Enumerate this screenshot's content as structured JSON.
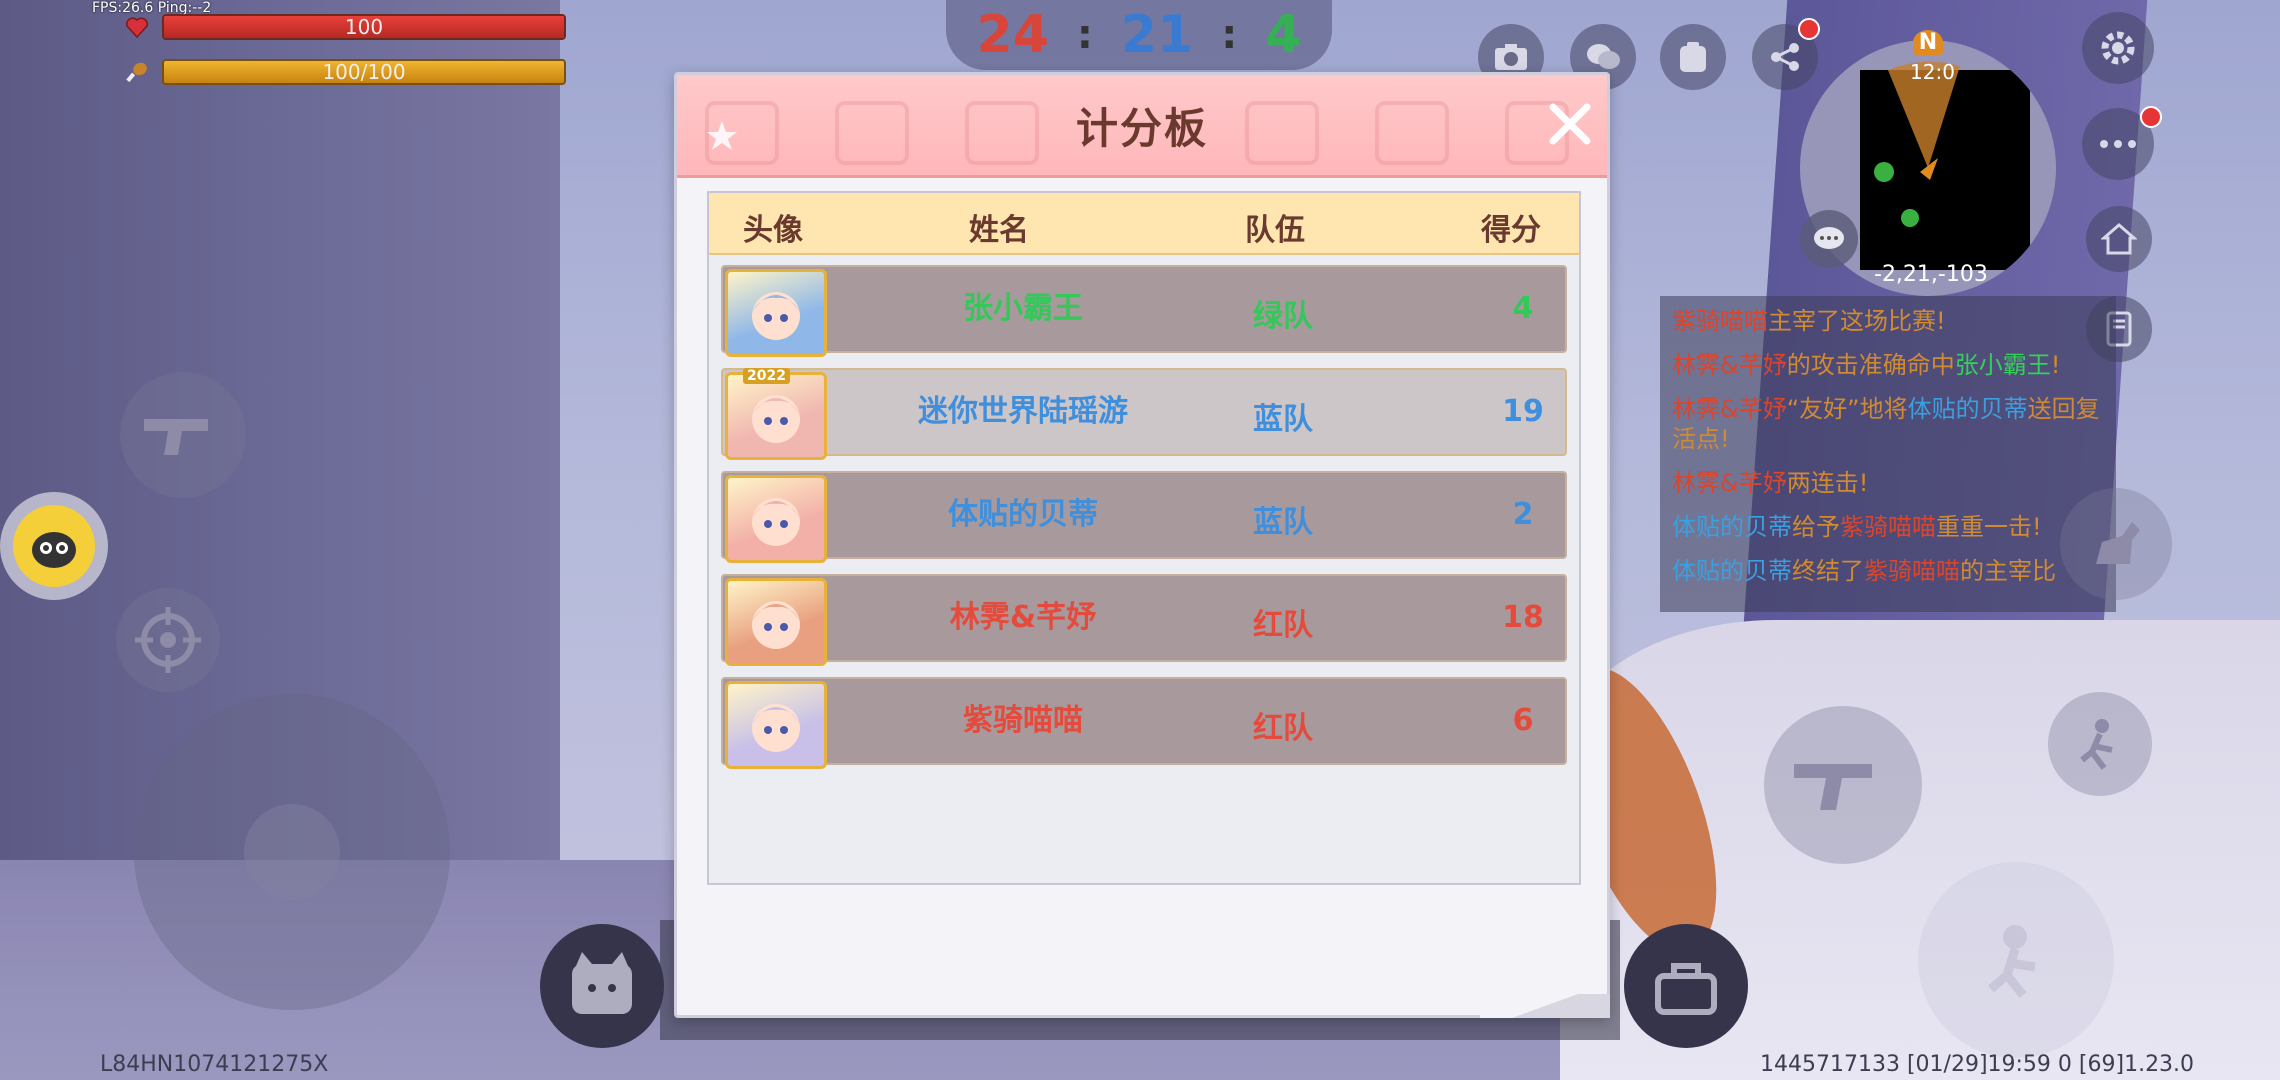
{
  "hud": {
    "fps_text": "FPS:26.6  Ping:--2",
    "hp_text": "100",
    "hp_fraction": 1.0,
    "hunger_text": "100/100",
    "hunger_fraction": 1.0
  },
  "team_score": {
    "red": "24",
    "blue": "21",
    "green": "4",
    "separator": ":"
  },
  "minimap": {
    "north_label": "N",
    "time": "12:0",
    "coords": "-2,21,-103"
  },
  "chat": {
    "lines": [
      [
        {
          "t": "紫骑喵喵",
          "c": "c-red"
        },
        {
          "t": "主宰了这场比赛!",
          "c": "c-white"
        }
      ],
      [
        {
          "t": "林霁&芊妤",
          "c": "c-red"
        },
        {
          "t": "的攻击准确命中",
          "c": "c-white"
        },
        {
          "t": "张小霸王",
          "c": "c-green"
        },
        {
          "t": "!",
          "c": "c-white"
        }
      ],
      [
        {
          "t": "林霁&芊妤",
          "c": "c-red"
        },
        {
          "t": "“友好”地将",
          "c": "c-white"
        },
        {
          "t": "体贴的贝蒂",
          "c": "c-blue"
        },
        {
          "t": "送回复活点!",
          "c": "c-white"
        }
      ],
      [
        {
          "t": "林霁&芊妤",
          "c": "c-red"
        },
        {
          "t": "两连击!",
          "c": "c-white"
        }
      ],
      [
        {
          "t": "体贴的贝蒂",
          "c": "c-blue"
        },
        {
          "t": "给予",
          "c": "c-white"
        },
        {
          "t": "紫骑喵喵",
          "c": "c-red"
        },
        {
          "t": "重重一击!",
          "c": "c-white"
        }
      ],
      [
        {
          "t": "体贴的贝蒂",
          "c": "c-blue"
        },
        {
          "t": "终结了",
          "c": "c-white"
        },
        {
          "t": "紫骑喵喵",
          "c": "c-red"
        },
        {
          "t": "的主宰比",
          "c": "c-white"
        }
      ]
    ]
  },
  "scoreboard": {
    "title": "计分板",
    "headers": {
      "avatar": "头像",
      "name": "姓名",
      "team": "队伍",
      "score": "得分"
    },
    "rows": [
      {
        "name": "张小霸王",
        "team": "绿队",
        "score": "4",
        "team_class": "t-green",
        "highlight": false,
        "avatar_color": "#8fb8e8",
        "avatar_badge": ""
      },
      {
        "name": "迷你世界陆瑶游",
        "team": "蓝队",
        "score": "19",
        "team_class": "t-blue",
        "highlight": true,
        "avatar_color": "#f0b6b0",
        "avatar_badge": "2022"
      },
      {
        "name": "体贴的贝蒂",
        "team": "蓝队",
        "score": "2",
        "team_class": "t-blue",
        "highlight": false,
        "avatar_color": "#f2b0a8",
        "avatar_badge": ""
      },
      {
        "name": "林霁&芊妤",
        "team": "红队",
        "score": "18",
        "team_class": "t-red",
        "highlight": false,
        "avatar_color": "#e8a080",
        "avatar_badge": ""
      },
      {
        "name": "紫骑喵喵",
        "team": "红队",
        "score": "6",
        "team_class": "t-red",
        "highlight": false,
        "avatar_color": "#c8c0e8",
        "avatar_badge": ""
      }
    ]
  },
  "footer": {
    "left_id": "L84HN1074121275X",
    "right_info": "1445717133   [01/29]19:59 0   [69]1.23.0"
  },
  "colors": {
    "team_red": "#e54b3c",
    "team_blue": "#3f8fdc",
    "team_green": "#35c759",
    "header_pink": "#ffc0c3",
    "table_header": "#ffe6b0"
  }
}
